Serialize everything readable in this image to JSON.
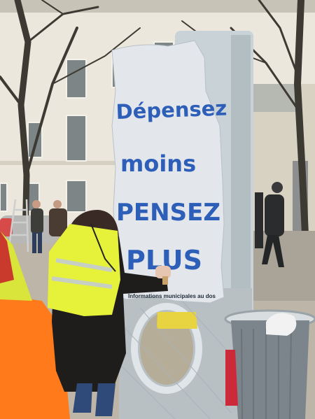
{
  "poster": {
    "line1": "Dépensez",
    "line2": "moins",
    "line3": "PENSEZ",
    "line4": "PLUS"
  },
  "panel": {
    "plate_text": "Informations municipales au dos"
  },
  "colors": {
    "paint_blue": "#2d5fb8",
    "safety_vest": "#e6f23a",
    "orange_jacket": "#ff7a1a",
    "panel_grey": "#c9d2d6"
  }
}
